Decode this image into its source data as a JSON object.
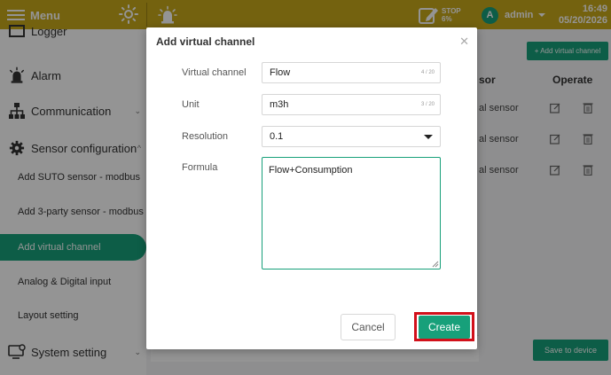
{
  "topbar": {
    "menu_label": "Menu",
    "stop_line1": "STOP",
    "stop_line2": "6%",
    "avatar_letter": "A",
    "user": "admin",
    "time": "16:49",
    "date": "05/20/2026"
  },
  "sidebar": {
    "partial_top": "Logger",
    "alarm": "Alarm",
    "communication": "Communication",
    "sensor_configuration": "Sensor configuration",
    "sub_items": [
      "Add SUTO sensor - modbus",
      "Add 3-party sensor - modbus",
      "Add virtual channel",
      "Analog & Digital input",
      "Layout setting"
    ],
    "system_setting": "System setting"
  },
  "main": {
    "add_virtual_channel_btn": "+ Add virtual channel",
    "col_sensor": "sor",
    "col_operate": "Operate",
    "rows": [
      "al sensor",
      "al sensor",
      "al sensor"
    ],
    "save_to_device": "Save to device"
  },
  "dialog": {
    "title": "Add virtual channel",
    "virtual_channel_label": "Virtual channel",
    "virtual_channel_value": "Flow",
    "virtual_channel_counter": "4 / 20",
    "unit_label": "Unit",
    "unit_value": "m3h",
    "unit_counter": "3 / 20",
    "resolution_label": "Resolution",
    "resolution_value": "0.1",
    "formula_label": "Formula",
    "formula_value": "Flow+Consumption",
    "cancel_label": "Cancel",
    "create_label": "Create"
  },
  "colors": {
    "topbar": "#c9a91b",
    "accent": "#17a07a",
    "highlight": "#d2101a"
  }
}
